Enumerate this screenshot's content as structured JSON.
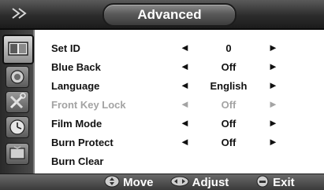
{
  "header": {
    "title": "Advanced",
    "corner_icon": "double-chevron-right-icon"
  },
  "sidebar": {
    "items": [
      {
        "icon": "picture-icon",
        "active": true
      },
      {
        "icon": "sound-icon",
        "active": false
      },
      {
        "icon": "tools-icon",
        "active": false
      },
      {
        "icon": "clock-icon",
        "active": false
      },
      {
        "icon": "tv-screen-icon",
        "active": false
      }
    ]
  },
  "menu": {
    "items": [
      {
        "label": "Set ID",
        "value": "0",
        "left_arrow": "◄",
        "right_arrow": "►",
        "enabled": true
      },
      {
        "label": "Blue Back",
        "value": "Off",
        "left_arrow": "◄",
        "right_arrow": "►",
        "enabled": true
      },
      {
        "label": "Language",
        "value": "English",
        "left_arrow": "◄",
        "right_arrow": "►",
        "enabled": true
      },
      {
        "label": "Front Key Lock",
        "value": "Off",
        "left_arrow": "◄",
        "right_arrow": "►",
        "enabled": false
      },
      {
        "label": "Film Mode",
        "value": "Off",
        "left_arrow": "◄",
        "right_arrow": "►",
        "enabled": true
      },
      {
        "label": "Burn Protect",
        "value": "Off",
        "left_arrow": "◄",
        "right_arrow": "►",
        "enabled": true
      },
      {
        "label": "Burn Clear",
        "enabled": true
      }
    ]
  },
  "footer": {
    "move_label": "Move",
    "adjust_label": "Adjust",
    "exit_label": "Exit"
  },
  "colors": {
    "bar_dark": "#2c2c2c",
    "disabled_text": "#a3a3a3",
    "text": "#111111"
  }
}
